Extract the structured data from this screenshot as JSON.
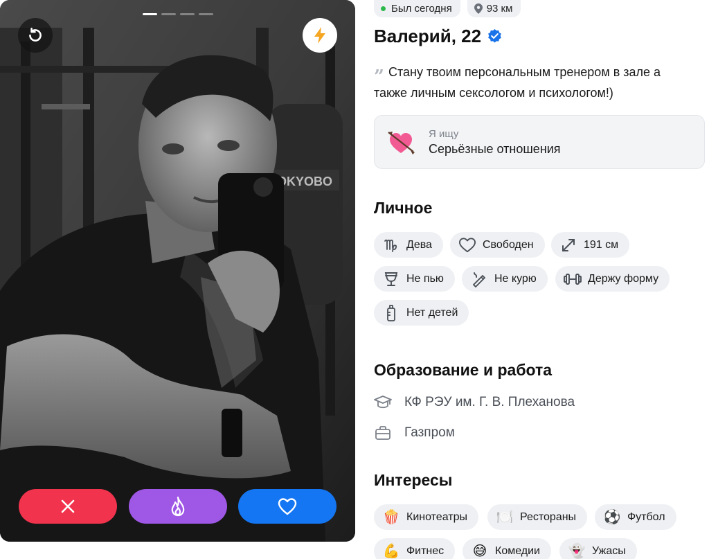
{
  "photo": {
    "progress_total": 4,
    "progress_active": 1,
    "punching_bag_text": "OKYOBO"
  },
  "actions": {
    "undo_icon": "undo-icon",
    "boost_icon": "lightning-icon",
    "dislike_icon": "close-icon",
    "superlike_icon": "flame-icon",
    "like_icon": "heart-icon",
    "colors": {
      "dislike": "#f2334d",
      "superlike": "#9f57e6",
      "like": "#1476f2",
      "boost": "#f5a623"
    }
  },
  "profile": {
    "online": "Был сегодня",
    "distance": "93 км",
    "name": "Валерий, 22",
    "verified": true,
    "bio": "Стану твоим персональным тренером в зале а также личным сексологом и психологом!)",
    "looking_for": {
      "label": "Я ищу",
      "value": "Серьёзные отношения"
    }
  },
  "personal": {
    "title": "Личное",
    "chips": [
      {
        "label": "Дева",
        "icon": "virgo-icon"
      },
      {
        "label": "Свободен",
        "icon": "heart-outline-icon"
      },
      {
        "label": "191 см",
        "icon": "expand-arrows-icon"
      },
      {
        "label": "Не пью",
        "icon": "wine-glass-icon"
      },
      {
        "label": "Не курю",
        "icon": "cigarette-icon"
      },
      {
        "label": "Держу форму",
        "icon": "dumbbell-icon"
      },
      {
        "label": "Нет детей",
        "icon": "baby-bottle-icon"
      }
    ]
  },
  "education": {
    "title": "Образование и работа",
    "university": "КФ РЭУ им. Г. В. Плеханова",
    "work": "Газпром"
  },
  "interests": {
    "title": "Интересы",
    "chips": [
      {
        "label": "Кинотеатры",
        "emoji": "🍿"
      },
      {
        "label": "Рестораны",
        "emoji": "🍽️"
      },
      {
        "label": "Футбол",
        "emoji": "⚽"
      },
      {
        "label": "Фитнес",
        "emoji": "💪"
      },
      {
        "label": "Комедии",
        "emoji": "😅"
      },
      {
        "label": "Ужасы",
        "emoji": "👻"
      }
    ]
  }
}
